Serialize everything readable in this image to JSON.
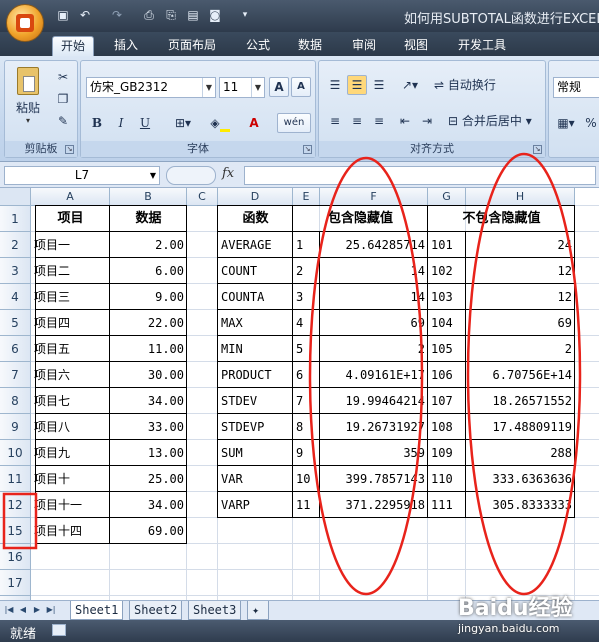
{
  "window": {
    "title": "如何用SUBTOTAL函数进行EXCEL"
  },
  "tabs": [
    "开始",
    "插入",
    "页面布局",
    "公式",
    "数据",
    "审阅",
    "视图",
    "开发工具"
  ],
  "ribbon": {
    "clipboard": {
      "label": "剪贴板",
      "paste": "粘贴"
    },
    "font": {
      "label": "字体",
      "font_name": "仿宋_GB2312",
      "font_size": "11",
      "bold": "B",
      "italic": "I",
      "underline": "U",
      "grow": "A",
      "shrink": "A",
      "fill_letter": "A",
      "phonetic": "wén"
    },
    "alignment": {
      "label": "对齐方式",
      "wrap_text": "自动换行",
      "merge_center": "合并后居中"
    },
    "number": {
      "format": "常规"
    }
  },
  "formula_bar": {
    "name_box": "L7",
    "fx": "fx",
    "value": ""
  },
  "columns": [
    "A",
    "B",
    "C",
    "D",
    "E",
    "F",
    "G",
    "H"
  ],
  "rows": [
    "1",
    "2",
    "3",
    "4",
    "5",
    "6",
    "7",
    "8",
    "9",
    "10",
    "11",
    "12",
    "15",
    "16",
    "17"
  ],
  "left_table": {
    "headers": [
      "项目",
      "数据"
    ],
    "rows": [
      [
        "项目一",
        "2.00"
      ],
      [
        "项目二",
        "6.00"
      ],
      [
        "项目三",
        "9.00"
      ],
      [
        "项目四",
        "22.00"
      ],
      [
        "项目五",
        "11.00"
      ],
      [
        "项目六",
        "30.00"
      ],
      [
        "项目七",
        "34.00"
      ],
      [
        "项目八",
        "33.00"
      ],
      [
        "项目九",
        "13.00"
      ],
      [
        "项目十",
        "25.00"
      ],
      [
        "项目十一",
        "34.00"
      ],
      [
        "项目十四",
        "69.00"
      ]
    ]
  },
  "right_table": {
    "headers": [
      "函数",
      "包含隐藏值",
      "不包含隐藏值"
    ],
    "rows": [
      [
        "AVERAGE",
        "1",
        "25.64285714",
        "101",
        "24"
      ],
      [
        "COUNT",
        "2",
        "14",
        "102",
        "12"
      ],
      [
        "COUNTA",
        "3",
        "14",
        "103",
        "12"
      ],
      [
        "MAX",
        "4",
        "69",
        "104",
        "69"
      ],
      [
        "MIN",
        "5",
        "2",
        "105",
        "2"
      ],
      [
        "PRODUCT",
        "6",
        "4.09161E+17",
        "106",
        "6.70756E+14"
      ],
      [
        "STDEV",
        "7",
        "19.99464214",
        "107",
        "18.26571552"
      ],
      [
        "STDEVP",
        "8",
        "19.26731927",
        "108",
        "17.48809119"
      ],
      [
        "SUM",
        "9",
        "359",
        "109",
        "288"
      ],
      [
        "VAR",
        "10",
        "399.7857143",
        "110",
        "333.6363636"
      ],
      [
        "VARP",
        "11",
        "371.2295918",
        "111",
        "305.8333333"
      ]
    ]
  },
  "sheets": [
    "Sheet1",
    "Sheet2",
    "Sheet3"
  ],
  "status": {
    "text": "就绪"
  },
  "watermark": {
    "logo": "Baidu经验",
    "url": "jingyan.baidu.com"
  },
  "colors": {
    "annotation": "#e8231b",
    "ribbon": "#c6d8ee",
    "titlebar": "#2e3b4c"
  }
}
